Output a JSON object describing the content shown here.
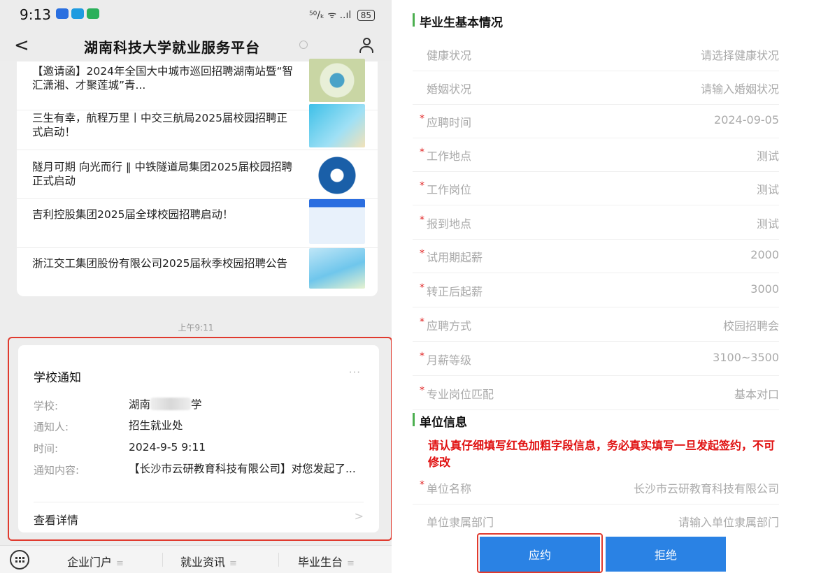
{
  "status_bar": {
    "time": "9:13",
    "signal": "⁵⁰/ₖ ᯤ ..ıl",
    "battery": "85"
  },
  "nav": {
    "back": "<",
    "title": "湖南科技大学就业服务平台"
  },
  "news": [
    {
      "text": "【邀请函】2024年全国大中城市巡回招聘湖南站暨“智汇潇湘、才聚莲城”青..."
    },
    {
      "text": "三生有幸，航程万里丨中交三航局2025届校园招聘正式启动！"
    },
    {
      "text": "隧月可期 向光而行 ‖ 中铁隧道局集团2025届校园招聘正式启动"
    },
    {
      "text": "吉利控股集团2025届全球校园招聘启动！"
    },
    {
      "text": "浙江交工集团股份有限公司2025届秋季校园招聘公告"
    }
  ],
  "timestamp": "上午9:11",
  "notice": {
    "title": "学校通知",
    "more": "···",
    "school_label": "学校:",
    "school_prefix": "湖南",
    "school_suffix": "学",
    "notifier_label": "通知人:",
    "notifier": "招生就业处",
    "time_label": "时间:",
    "time": "2024-9-5 9:11",
    "content_label": "通知内容:",
    "content": "【长沙市云研教育科技有限公司】对您发起了...",
    "detail": "查看详情",
    "detail_chevron": ">"
  },
  "bottom_menu": [
    {
      "label": "企业门户",
      "eq": "≡"
    },
    {
      "label": "就业资讯",
      "eq": "≡"
    },
    {
      "label": "毕业生台",
      "eq": "≡"
    }
  ],
  "form": {
    "section1": "毕业生基本情况",
    "fields": [
      {
        "label": "健康状况",
        "value": "请选择健康状况",
        "required": false
      },
      {
        "label": "婚姻状况",
        "value": "请输入婚姻状况",
        "required": false
      },
      {
        "label": "应聘时间",
        "value": "2024-09-05",
        "required": true
      },
      {
        "label": "工作地点",
        "value": "测试",
        "required": true
      },
      {
        "label": "工作岗位",
        "value": "测试",
        "required": true
      },
      {
        "label": "报到地点",
        "value": "测试",
        "required": true
      },
      {
        "label": "试用期起薪",
        "value": "2000",
        "required": true
      },
      {
        "label": "转正后起薪",
        "value": "3000",
        "required": true
      },
      {
        "label": "应聘方式",
        "value": "校园招聘会",
        "required": true
      },
      {
        "label": "月薪等级",
        "value": "3100~3500",
        "required": true
      },
      {
        "label": "专业岗位匹配",
        "value": "基本对口",
        "required": true
      }
    ],
    "section2": "单位信息",
    "warning": "请认真仔细填写红色加粗字段信息，务必真实填写一旦发起签约，不可修改",
    "unit_fields": [
      {
        "label": "单位名称",
        "value": "长沙市云研教育科技有限公司",
        "required": true
      },
      {
        "label": "单位隶属部门",
        "value": "请输入单位隶属部门",
        "required": false
      }
    ],
    "accept": "应约",
    "reject": "拒绝",
    "required_mark": "*"
  },
  "colors": {
    "accent": "#2a82e4",
    "highlight": "#e03a2e",
    "section_bar": "#4caf50",
    "warning": "#e01010"
  }
}
